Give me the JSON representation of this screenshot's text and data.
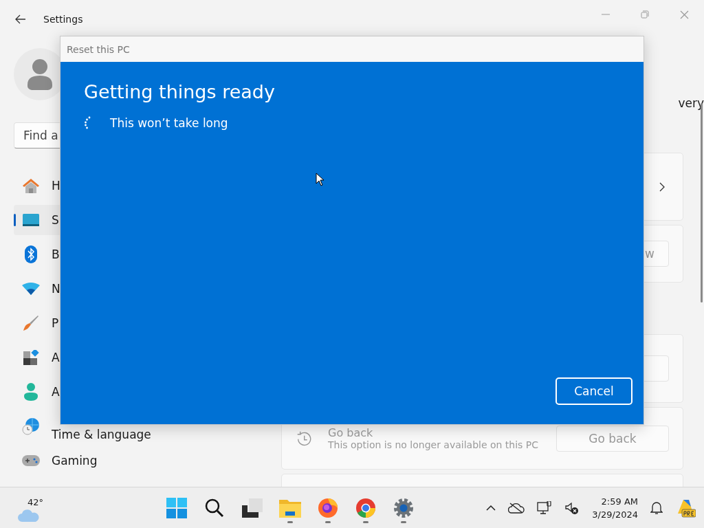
{
  "window": {
    "title": "Settings"
  },
  "search": {
    "placeholder": "Find a"
  },
  "sidebar": {
    "items": [
      {
        "kind": "home",
        "label": "H",
        "selected": false
      },
      {
        "kind": "system",
        "label": "S",
        "selected": true
      },
      {
        "kind": "bluetooth",
        "label": "B",
        "selected": false
      },
      {
        "kind": "network",
        "label": "N",
        "selected": false
      },
      {
        "kind": "brush",
        "label": "P",
        "selected": false
      },
      {
        "kind": "apps",
        "label": "A",
        "selected": false
      },
      {
        "kind": "accounts",
        "label": "A",
        "selected": false
      },
      {
        "kind": "time",
        "label": "Time & language",
        "selected": false
      },
      {
        "kind": "gaming",
        "label": "Gaming",
        "selected": false
      }
    ]
  },
  "page_heading": "very",
  "cards": [
    {
      "kind": "chevron"
    },
    {
      "kind": "button",
      "button": "w"
    },
    {
      "kind": "button"
    },
    {
      "kind": "go_back",
      "title": "Go back",
      "subtitle": "This option is no longer available on this PC",
      "button": "Go back",
      "disabled": true
    },
    {
      "kind": "empty"
    }
  ],
  "dialog": {
    "title": "Reset this PC",
    "heading": "Getting things ready",
    "status": "This won’t take long",
    "button": "Cancel"
  },
  "taskbar": {
    "weather": "42°",
    "apps": [
      {
        "kind": "start",
        "running": false
      },
      {
        "kind": "search",
        "running": false
      },
      {
        "kind": "taskview",
        "running": false
      },
      {
        "kind": "explorer",
        "running": true
      },
      {
        "kind": "firefox",
        "running": true
      },
      {
        "kind": "chrome",
        "running": true
      },
      {
        "kind": "settings",
        "running": true
      }
    ],
    "time": "2:59 AM",
    "date": "3/29/2024"
  }
}
